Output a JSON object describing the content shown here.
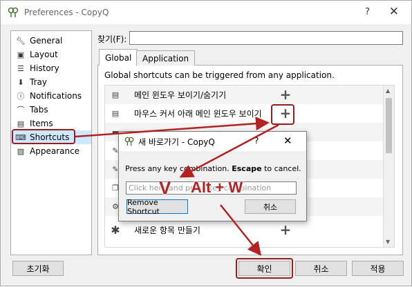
{
  "window": {
    "title": "Preferences - CopyQ",
    "help": "?",
    "close": "✕"
  },
  "sidebar": {
    "items": [
      {
        "label": "General",
        "icon": "wrench-icon"
      },
      {
        "label": "Layout",
        "icon": "layout-icon"
      },
      {
        "label": "History",
        "icon": "list-icon"
      },
      {
        "label": "Tray",
        "icon": "tray-icon"
      },
      {
        "label": "Notifications",
        "icon": "info-icon"
      },
      {
        "label": "Tabs",
        "icon": "tabs-icon"
      },
      {
        "label": "Items",
        "icon": "items-icon"
      },
      {
        "label": "Shortcuts",
        "icon": "keyboard-icon"
      },
      {
        "label": "Appearance",
        "icon": "image-icon"
      }
    ],
    "selected": "Shortcuts"
  },
  "find": {
    "label": "찾기(F):",
    "value": ""
  },
  "tabs": [
    {
      "label": "Global",
      "active": true
    },
    {
      "label": "Application",
      "active": false
    }
  ],
  "panel": {
    "description": "Global shortcuts can be triggered from any application."
  },
  "shortcuts": [
    {
      "label": "메인 윈도우 보이기/숨기기",
      "action": "+"
    },
    {
      "label": "마우스 커서 아래 메인 윈도우 보이기",
      "action": "+"
    },
    {
      "label": "",
      "action": ""
    },
    {
      "label": "",
      "action": ""
    },
    {
      "label": "",
      "action": ""
    },
    {
      "label": "",
      "action": ""
    },
    {
      "label": "",
      "action": ""
    },
    {
      "label": "새로운 항목 만들기",
      "action": "+"
    }
  ],
  "dialog": {
    "title": "새 바로가기 - CopyQ",
    "help": "?",
    "close": "✕",
    "msg_prefix": "Press any key combination.",
    "msg_bold": "Escape",
    "msg_suffix": "to cancel.",
    "input_placeholder": "Click here and press key combination",
    "remove_button": "Remove Shortcut",
    "cancel_button": "취소"
  },
  "annotation": {
    "check": "V",
    "keys": "Alt + W",
    "color": "#b22222"
  },
  "footer": {
    "reset": "초기화",
    "ok": "확인",
    "cancel": "취소",
    "apply": "적용"
  }
}
